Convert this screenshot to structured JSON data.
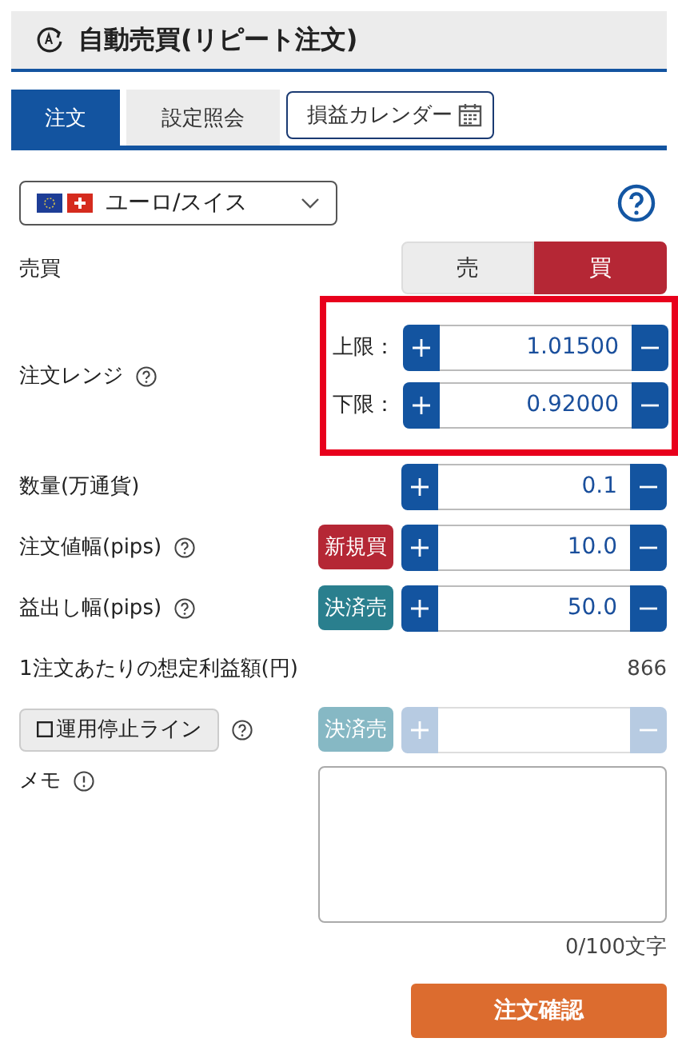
{
  "header": {
    "title": "自動売買(リピート注文)"
  },
  "tabs": [
    {
      "label": "注文",
      "selected": true,
      "kind": "plain"
    },
    {
      "label": "設定照会",
      "selected": false,
      "kind": "plain"
    },
    {
      "label": "損益カレンダー",
      "selected": false,
      "kind": "calendar"
    }
  ],
  "currency": {
    "value": "ユーロ/スイス"
  },
  "side": {
    "label": "売買",
    "options": [
      {
        "label": "売",
        "selected": false,
        "kind": "sell"
      },
      {
        "label": "買",
        "selected": true,
        "kind": "buy"
      }
    ]
  },
  "range": {
    "label": "注文レンジ",
    "highlighted": true,
    "limits": [
      {
        "label": "上限：",
        "value": "1.01500"
      },
      {
        "label": "下限：",
        "value": "0.92000"
      }
    ]
  },
  "rows": [
    {
      "kind": "stepper",
      "label": "数量(万通貨)",
      "help": false,
      "value": "0.1",
      "disabled": false
    },
    {
      "kind": "stepper",
      "label": "注文値幅(pips)",
      "help": true,
      "tag": {
        "label": "新規買",
        "color": "#b52735"
      },
      "value": "10.0",
      "disabled": false
    },
    {
      "kind": "stepper",
      "label": "益出し幅(pips)",
      "help": true,
      "tag": {
        "label": "決済売",
        "color": "#2a7f8e"
      },
      "value": "50.0",
      "disabled": false
    },
    {
      "kind": "text",
      "label": "1注文あたりの想定利益額(円)",
      "value": "866"
    },
    {
      "kind": "stop",
      "label": "運用停止ライン",
      "checked": false,
      "help": true,
      "tag": {
        "label": "決済売",
        "color": "#86b8c4"
      },
      "disabled": true
    }
  ],
  "memo": {
    "label": "メモ",
    "counter": "0/100文字"
  },
  "submit": {
    "label": "注文確認"
  }
}
